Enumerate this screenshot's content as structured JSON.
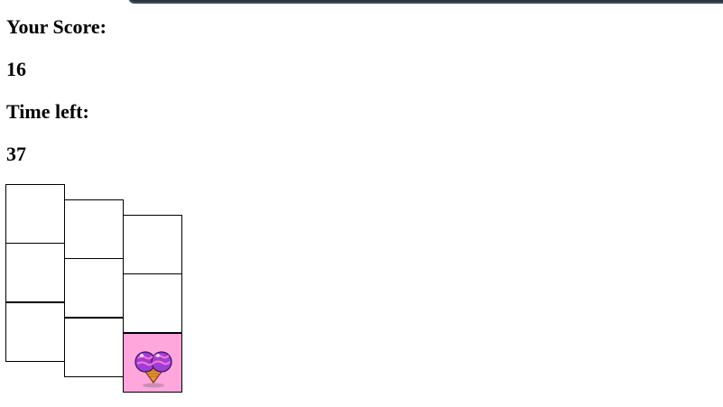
{
  "score": {
    "label": "Your Score:",
    "value": "16"
  },
  "time": {
    "label": "Time left:",
    "value": "37"
  },
  "grid": {
    "columns": 3,
    "rows": 3,
    "active_cell": {
      "column": 3,
      "row": 3,
      "sprite": "heart-ice-cream-icon"
    },
    "active_color": "#ffa6dd",
    "border_color": "#000000"
  }
}
